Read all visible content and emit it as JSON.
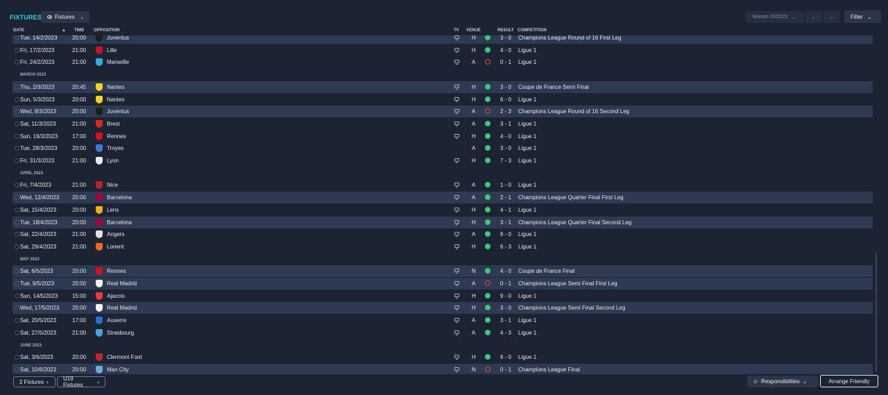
{
  "header": {
    "title": "FIXTURES",
    "view_label": "Fixtures",
    "season_label": "Season 2022/23",
    "filter_label": "Filter",
    "prev_icon": "chevron-left-icon",
    "next_icon": "chevron-right-icon"
  },
  "columns": {
    "date": "DATE",
    "time": "TIME",
    "opposition": "OPPOSITION",
    "tv": "TV",
    "venue": "VENUE",
    "result": "RESULT",
    "competition": "COMPETITION"
  },
  "colors": {
    "accent": "#2fd3e6",
    "win": "#3dc77a",
    "loss": "#e04a4a",
    "row_highlight": "#2d3a52"
  },
  "rows": [
    {
      "kind": "fixture",
      "date": "Tue, 14/2/2023",
      "time": "20:00",
      "team": "Juventus",
      "crest": "#1d1d1d",
      "tv": true,
      "venue": "H",
      "outcome": "win",
      "score": "3 - 0",
      "competition": "Champions League Round of 16 First Leg",
      "hl": true
    },
    {
      "kind": "fixture",
      "date": "Fri, 17/2/2023",
      "time": "21:00",
      "team": "Lille",
      "crest": "#c8102e",
      "tv": true,
      "venue": "H",
      "outcome": "win",
      "score": "4 - 0",
      "competition": "Ligue 1",
      "hl": false
    },
    {
      "kind": "fixture",
      "date": "Fri, 24/2/2023",
      "time": "21:00",
      "team": "Marseille",
      "crest": "#2faee0",
      "tv": true,
      "venue": "A",
      "outcome": "loss",
      "score": "0 - 1",
      "competition": "Ligue 1",
      "hl": false
    },
    {
      "kind": "month",
      "label": "MARCH 2023"
    },
    {
      "kind": "fixture",
      "date": "Thu, 2/3/2023",
      "time": "20:45",
      "team": "Nantes",
      "crest": "#f4d21f",
      "tv": true,
      "venue": "H",
      "outcome": "win",
      "score": "3 - 0",
      "competition": "Coupe de France Semi Final",
      "hl": true
    },
    {
      "kind": "fixture",
      "date": "Sun, 5/3/2023",
      "time": "20:00",
      "team": "Nantes",
      "crest": "#f4d21f",
      "tv": true,
      "venue": "H",
      "outcome": "win",
      "score": "6 - 0",
      "competition": "Ligue 1",
      "hl": false
    },
    {
      "kind": "fixture",
      "date": "Wed, 8/3/2023",
      "time": "20:00",
      "team": "Juventus",
      "crest": "#1d1d1d",
      "tv": true,
      "venue": "A",
      "outcome": "loss",
      "score": "2 - 3",
      "competition": "Champions League Round of 16 Second Leg",
      "hl": true
    },
    {
      "kind": "fixture",
      "date": "Sat, 11/3/2023",
      "time": "21:00",
      "team": "Brest",
      "crest": "#d52b1e",
      "tv": true,
      "venue": "A",
      "outcome": "win",
      "score": "3 - 1",
      "competition": "Ligue 1",
      "hl": false
    },
    {
      "kind": "fixture",
      "date": "Sun, 19/3/2023",
      "time": "17:00",
      "team": "Rennes",
      "crest": "#d1121b",
      "tv": true,
      "venue": "H",
      "outcome": "win",
      "score": "4 - 0",
      "competition": "Ligue 1",
      "hl": false
    },
    {
      "kind": "fixture",
      "date": "Tue, 28/3/2023",
      "time": "20:00",
      "team": "Troyes",
      "crest": "#3a7bd5",
      "tv": false,
      "venue": "A",
      "outcome": "win",
      "score": "3 - 0",
      "competition": "Ligue 1",
      "hl": false
    },
    {
      "kind": "fixture",
      "date": "Fri, 31/3/2023",
      "time": "21:00",
      "team": "Lyon",
      "crest": "#e8e8e8",
      "tv": true,
      "venue": "H",
      "outcome": "win",
      "score": "7 - 3",
      "competition": "Ligue 1",
      "hl": false
    },
    {
      "kind": "month",
      "label": "APRIL 2023"
    },
    {
      "kind": "fixture",
      "date": "Fri, 7/4/2023",
      "time": "21:00",
      "team": "Nice",
      "crest": "#b8252a",
      "tv": true,
      "venue": "A",
      "outcome": "win",
      "score": "1 - 0",
      "competition": "Ligue 1",
      "hl": false
    },
    {
      "kind": "fixture",
      "date": "Wed, 12/4/2023",
      "time": "20:00",
      "team": "Barcelona",
      "crest": "#a50044",
      "tv": true,
      "venue": "A",
      "outcome": "win",
      "score": "2 - 1",
      "competition": "Champions League Quarter Final First Leg",
      "hl": true
    },
    {
      "kind": "fixture",
      "date": "Sat, 15/4/2023",
      "time": "20:00",
      "team": "Lens",
      "crest": "#e8b70f",
      "tv": true,
      "venue": "H",
      "outcome": "win",
      "score": "4 - 1",
      "competition": "Ligue 1",
      "hl": false
    },
    {
      "kind": "fixture",
      "date": "Tue, 18/4/2023",
      "time": "20:00",
      "team": "Barcelona",
      "crest": "#a50044",
      "tv": true,
      "venue": "H",
      "outcome": "win",
      "score": "3 - 1",
      "competition": "Champions League Quarter Final Second Leg",
      "hl": true
    },
    {
      "kind": "fixture",
      "date": "Sat, 22/4/2023",
      "time": "21:00",
      "team": "Angers",
      "crest": "#e0e0e0",
      "tv": true,
      "venue": "A",
      "outcome": "win",
      "score": "6 - 0",
      "competition": "Ligue 1",
      "hl": false
    },
    {
      "kind": "fixture",
      "date": "Sat, 29/4/2023",
      "time": "21:00",
      "team": "Lorient",
      "crest": "#f26b1d",
      "tv": true,
      "venue": "H",
      "outcome": "win",
      "score": "6 - 3",
      "competition": "Ligue 1",
      "hl": false
    },
    {
      "kind": "month",
      "label": "MAY 2023"
    },
    {
      "kind": "fixture",
      "date": "Sat, 6/5/2023",
      "time": "20:00",
      "team": "Rennes",
      "crest": "#d1121b",
      "tv": true,
      "venue": "N",
      "outcome": "win",
      "score": "4 - 0",
      "competition": "Coupe de France Final",
      "hl": true
    },
    {
      "kind": "fixture",
      "date": "Tue, 9/5/2023",
      "time": "20:00",
      "team": "Real Madrid",
      "crest": "#f2f2f2",
      "tv": true,
      "venue": "A",
      "outcome": "loss",
      "score": "0 - 1",
      "competition": "Champions League Semi Final First Leg",
      "hl": true
    },
    {
      "kind": "fixture",
      "date": "Sun, 14/5/2023",
      "time": "15:00",
      "team": "Ajaccio",
      "crest": "#e63d3d",
      "tv": true,
      "venue": "H",
      "outcome": "win",
      "score": "9 - 0",
      "competition": "Ligue 1",
      "hl": false
    },
    {
      "kind": "fixture",
      "date": "Wed, 17/5/2023",
      "time": "20:00",
      "team": "Real Madrid",
      "crest": "#f2f2f2",
      "tv": true,
      "venue": "H",
      "outcome": "win",
      "score": "3 - 0",
      "competition": "Champions League Semi Final Second Leg",
      "hl": true
    },
    {
      "kind": "fixture",
      "date": "Sat, 20/5/2023",
      "time": "17:00",
      "team": "Auxerre",
      "crest": "#2a6fc9",
      "tv": true,
      "venue": "A",
      "outcome": "win",
      "score": "3 - 1",
      "competition": "Ligue 1",
      "hl": false
    },
    {
      "kind": "fixture",
      "date": "Sat, 27/5/2023",
      "time": "21:00",
      "team": "Strasbourg",
      "crest": "#4aa0e0",
      "tv": true,
      "venue": "A",
      "outcome": "win",
      "score": "4 - 3",
      "competition": "Ligue 1",
      "hl": false
    },
    {
      "kind": "month",
      "label": "JUNE 2023"
    },
    {
      "kind": "fixture",
      "date": "Sat, 3/6/2023",
      "time": "20:00",
      "team": "Clermont Foot",
      "crest": "#c1272d",
      "tv": true,
      "venue": "H",
      "outcome": "win",
      "score": "6 - 0",
      "competition": "Ligue 1",
      "hl": false
    },
    {
      "kind": "fixture",
      "date": "Sat, 10/6/2023",
      "time": "20:00",
      "team": "Man City",
      "crest": "#6cabdd",
      "tv": true,
      "venue": "N",
      "outcome": "loss",
      "score": "0 - 1",
      "competition": "Champions League Final",
      "hl": true
    }
  ],
  "footer": {
    "fixtures_link": "2 Fixtures",
    "u19_link": "U19 Fixtures",
    "responsibilities": "Responsibilities",
    "arrange": "Arrange Friendly"
  }
}
